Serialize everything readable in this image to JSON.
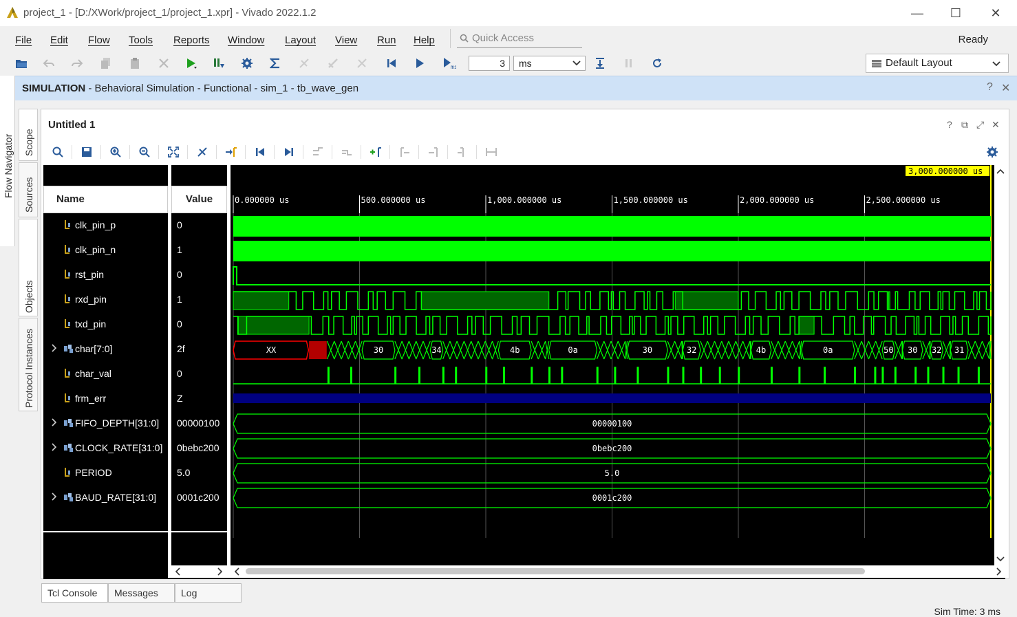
{
  "window": {
    "title": "project_1 - [D:/XWork/project_1/project_1.xpr] - Vivado 2022.1.2",
    "minimize": "—",
    "maximize": "☐",
    "close": "✕"
  },
  "menu": [
    "File",
    "Edit",
    "Flow",
    "Tools",
    "Reports",
    "Window",
    "Layout",
    "View",
    "Run",
    "Help"
  ],
  "quick_access_placeholder": "Quick Access",
  "status_ready": "Ready",
  "toolbar": {
    "run_time_value": "3",
    "run_time_unit": "ms",
    "layout": "Default Layout",
    "icons": [
      "open-project-icon",
      "undo-icon",
      "redo-icon",
      "copy-icon",
      "paste-icon",
      "delete-icon",
      "run-icon",
      "run-all-icon",
      "settings-icon",
      "sigma-icon",
      "disabled-tool-icon",
      "disabled-tool-icon",
      "disabled-tool-icon",
      "restart-icon",
      "run-all-play-icon",
      "run-for-icon",
      "step-icon",
      "break-icon",
      "relaunch-icon"
    ]
  },
  "simbar": {
    "label_bold": "SIMULATION",
    "label_rest": " - Behavioral Simulation - Functional - sim_1 - tb_wave_gen",
    "help": "?",
    "close": "✕"
  },
  "left_rail": {
    "flow_navigator": "Flow Navigator"
  },
  "side_tabs": [
    "Scope",
    "Sources",
    "Objects",
    "Protocol Instances"
  ],
  "wave_window": {
    "title": "Untitled 1",
    "controls": [
      "?",
      "⧉",
      "⤢",
      "✕"
    ],
    "columns": {
      "name": "Name",
      "value": "Value"
    },
    "cursor_time": "3,000.000000 us",
    "ticks": [
      "0.000000 us",
      "500.000000 us",
      "1,000.000000 us",
      "1,500.000000 us",
      "2,000.000000 us",
      "2,500.000000 us"
    ],
    "signals": [
      {
        "name": "clk_pin_p",
        "value": "0",
        "kind": "bit",
        "expand": false
      },
      {
        "name": "clk_pin_n",
        "value": "1",
        "kind": "bit",
        "expand": false
      },
      {
        "name": "rst_pin",
        "value": "0",
        "kind": "bit",
        "expand": false
      },
      {
        "name": "rxd_pin",
        "value": "1",
        "kind": "bit",
        "expand": false
      },
      {
        "name": "txd_pin",
        "value": "0",
        "kind": "bit",
        "expand": false
      },
      {
        "name": "char[7:0]",
        "value": "2f",
        "kind": "bus",
        "expand": true
      },
      {
        "name": "char_val",
        "value": "0",
        "kind": "bit",
        "expand": false
      },
      {
        "name": "frm_err",
        "value": "Z",
        "kind": "bit",
        "expand": false
      },
      {
        "name": "FIFO_DEPTH[31:0]",
        "value": "00000100",
        "kind": "bus",
        "expand": true
      },
      {
        "name": "CLOCK_RATE[31:0]",
        "value": "0bebc200",
        "kind": "bus",
        "expand": true
      },
      {
        "name": "PERIOD",
        "value": "5.0",
        "kind": "bit",
        "expand": false
      },
      {
        "name": "BAUD_RATE[31:0]",
        "value": "0001c200",
        "kind": "bus",
        "expand": true
      }
    ],
    "char_labels": [
      "XX",
      "30",
      "34",
      "4b",
      "0a",
      "30",
      "32",
      "4b",
      "0a",
      "50",
      "30",
      "32",
      "31"
    ],
    "const_labels": [
      "00000100",
      "0bebc200",
      "5.0",
      "0001c200"
    ]
  },
  "bottom_tabs": [
    "Tcl Console",
    "Messages",
    "Log"
  ],
  "status": {
    "sim_time": "Sim Time: 3 ms"
  },
  "colors": {
    "wave_green": "#00ff00",
    "wave_dark": "#006600",
    "wave_red": "#ff0000",
    "wave_blue": "#000080",
    "cursor_yellow": "#ffff00"
  }
}
